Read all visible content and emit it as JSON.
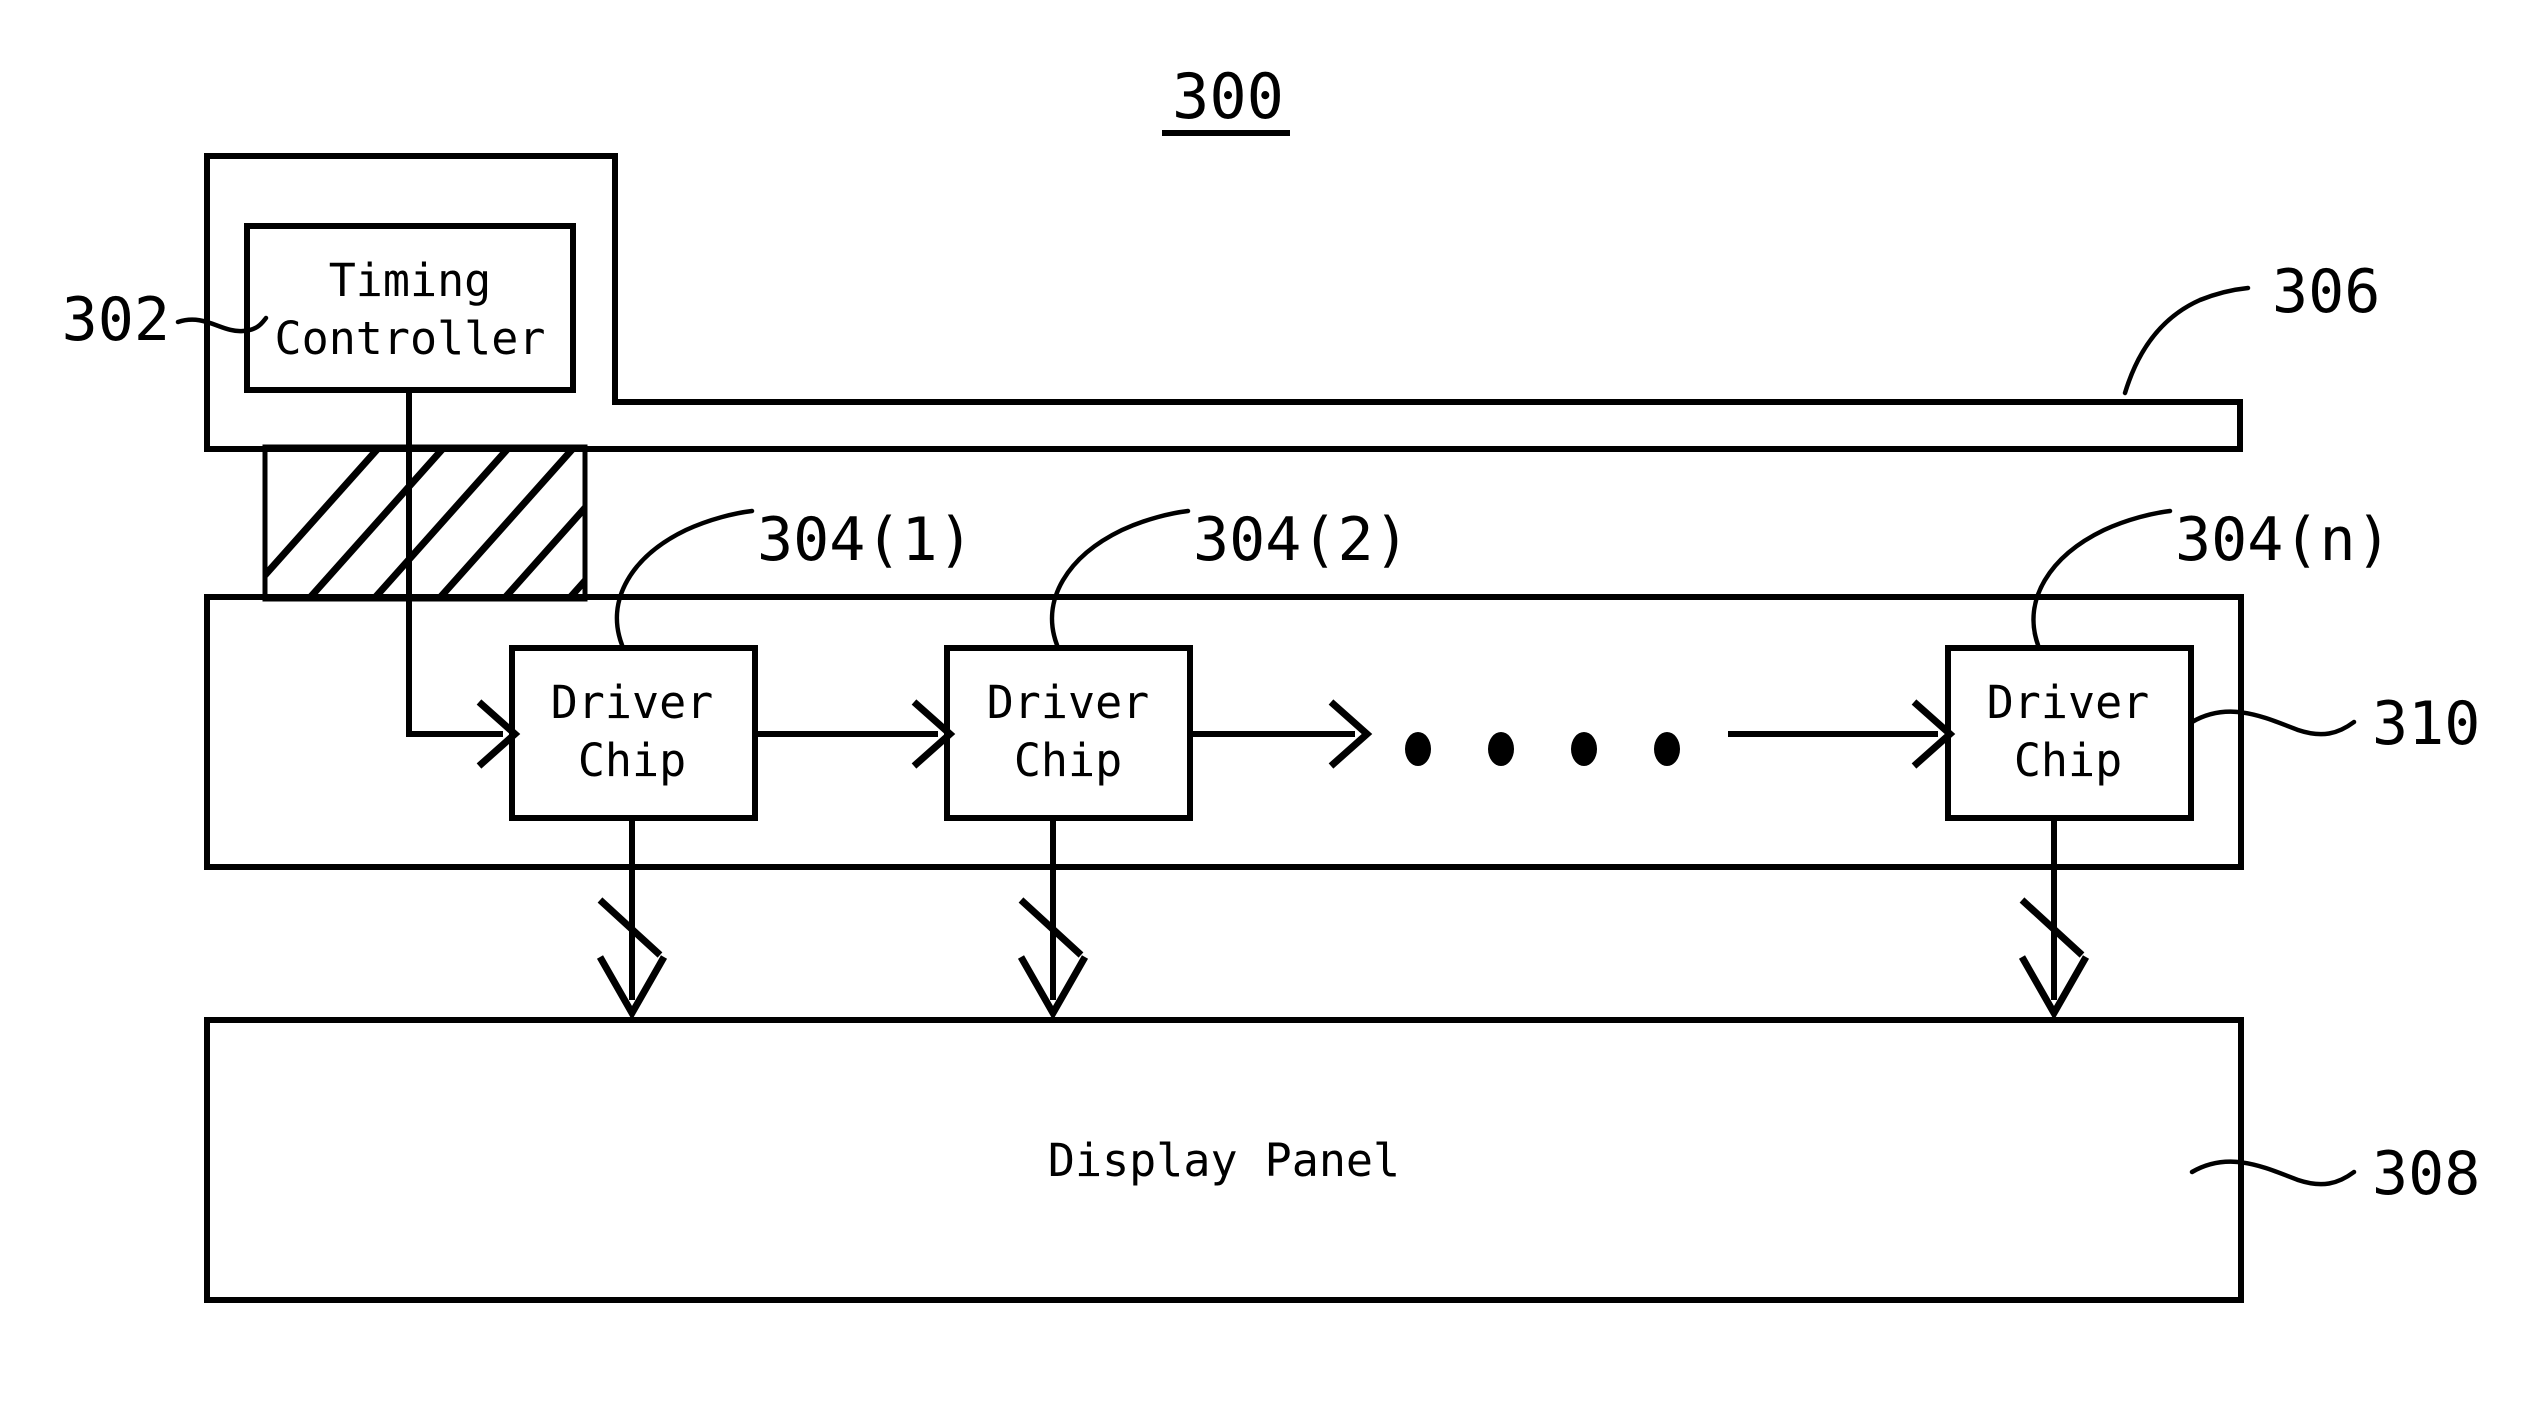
{
  "figure": {
    "number": "300",
    "number_underlined": true,
    "background_color": "#ffffff",
    "line_color": "#000000"
  },
  "blocks": {
    "timing_controller": {
      "label_line_1": "Timing",
      "label_line_2": "Controller"
    },
    "driver_chip_1": {
      "label_line_1": "Driver",
      "label_line_2": "Chip"
    },
    "driver_chip_2": {
      "label_line_1": "Driver",
      "label_line_2": "Chip"
    },
    "driver_chip_n": {
      "label_line_1": "Driver",
      "label_line_2": "Chip"
    },
    "display_panel": {
      "label": "Display Panel"
    }
  },
  "reference_numerals": {
    "pcb": "302",
    "flexible_circuit": "306",
    "driver_chip_first": "304(1)",
    "driver_chip_second": "304(2)",
    "driver_chip_last": "304(n)",
    "chip_on_film_carrier": "310",
    "panel": "308"
  },
  "ellipsis": {
    "dot_count": 4,
    "meaning": "continuation-between-driver-chips"
  }
}
